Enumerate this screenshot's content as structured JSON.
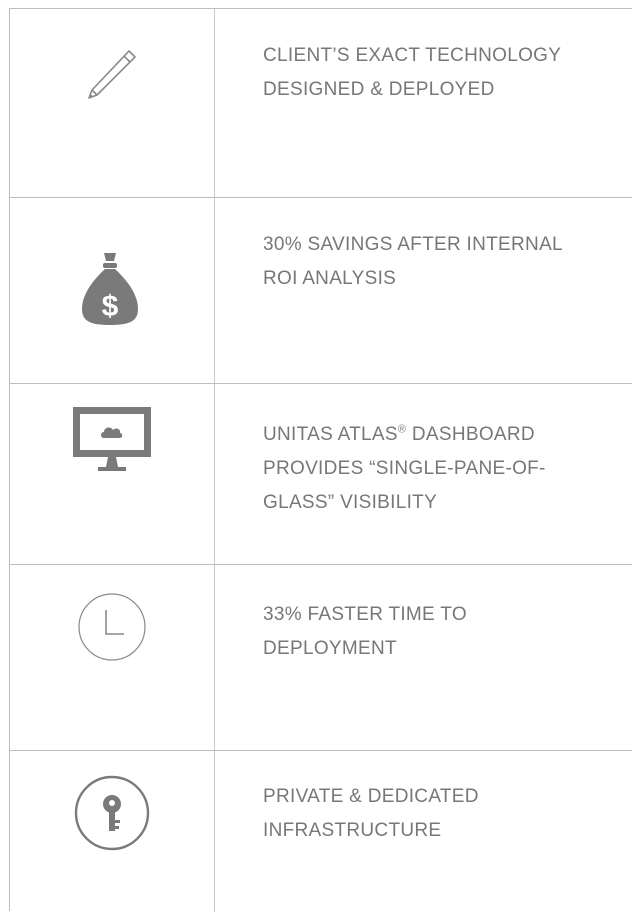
{
  "rows": [
    {
      "icon": "pencil-icon",
      "lines": [
        "CLIENT’S EXACT TECHNOLOGY",
        "DESIGNED & DEPLOYED"
      ]
    },
    {
      "icon": "money-bag-icon",
      "icon_text": "$",
      "lines": [
        "30% SAVINGS AFTER INTERNAL",
        "ROI ANALYSIS"
      ]
    },
    {
      "icon": "monitor-cloud-icon",
      "line1_pre": "UNITAS ATLAS",
      "line1_reg": "®",
      "line1_post": " DASHBOARD",
      "lines": [
        "PROVIDES “SINGLE-PANE-OF-",
        "GLASS” VISIBILITY"
      ]
    },
    {
      "icon": "clock-icon",
      "lines": [
        "33% FASTER TIME TO",
        "DEPLOYMENT"
      ]
    },
    {
      "icon": "key-icon",
      "lines": [
        "PRIVATE & DEDICATED",
        "INFRASTRUCTURE"
      ]
    }
  ],
  "colors": {
    "text": "#777777",
    "icon": "#7a7a7a",
    "border": "#bdbdbd"
  }
}
